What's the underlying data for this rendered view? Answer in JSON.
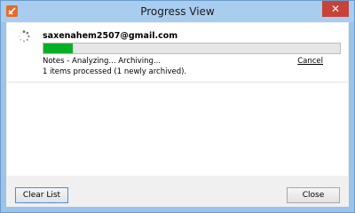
{
  "window": {
    "title": "Progress View",
    "close_glyph": "✕"
  },
  "item": {
    "account": "saxenahem2507@gmail.com",
    "progress": 0.1,
    "status": "Notes - Analyzing... Archiving...",
    "processed": "1 items processed (1 newly archived).",
    "cancel_label": "Cancel"
  },
  "buttons": {
    "clear_list": "Clear List",
    "close": "Close"
  },
  "colors": {
    "progress_fill": "#06b025",
    "app_icon": "#e86a2a"
  },
  "icons": {
    "app": "mailstore-app-icon",
    "spinner": "loading-spinner-icon"
  }
}
